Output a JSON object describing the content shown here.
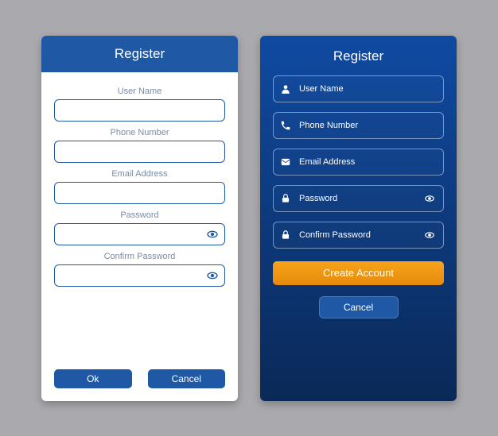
{
  "light": {
    "title": "Register",
    "fields": {
      "username": "User Name",
      "phone": "Phone Number",
      "email": "Email Address",
      "password": "Password",
      "confirm": "Confirm Password"
    },
    "buttons": {
      "ok": "Ok",
      "cancel": "Cancel"
    }
  },
  "dark": {
    "title": "Register",
    "fields": {
      "username": "User Name",
      "phone": "Phone Number",
      "email": "Email Address",
      "password": "Password",
      "confirm": "Confirm Password"
    },
    "buttons": {
      "create": "Create Account",
      "cancel": "Cancel"
    }
  }
}
